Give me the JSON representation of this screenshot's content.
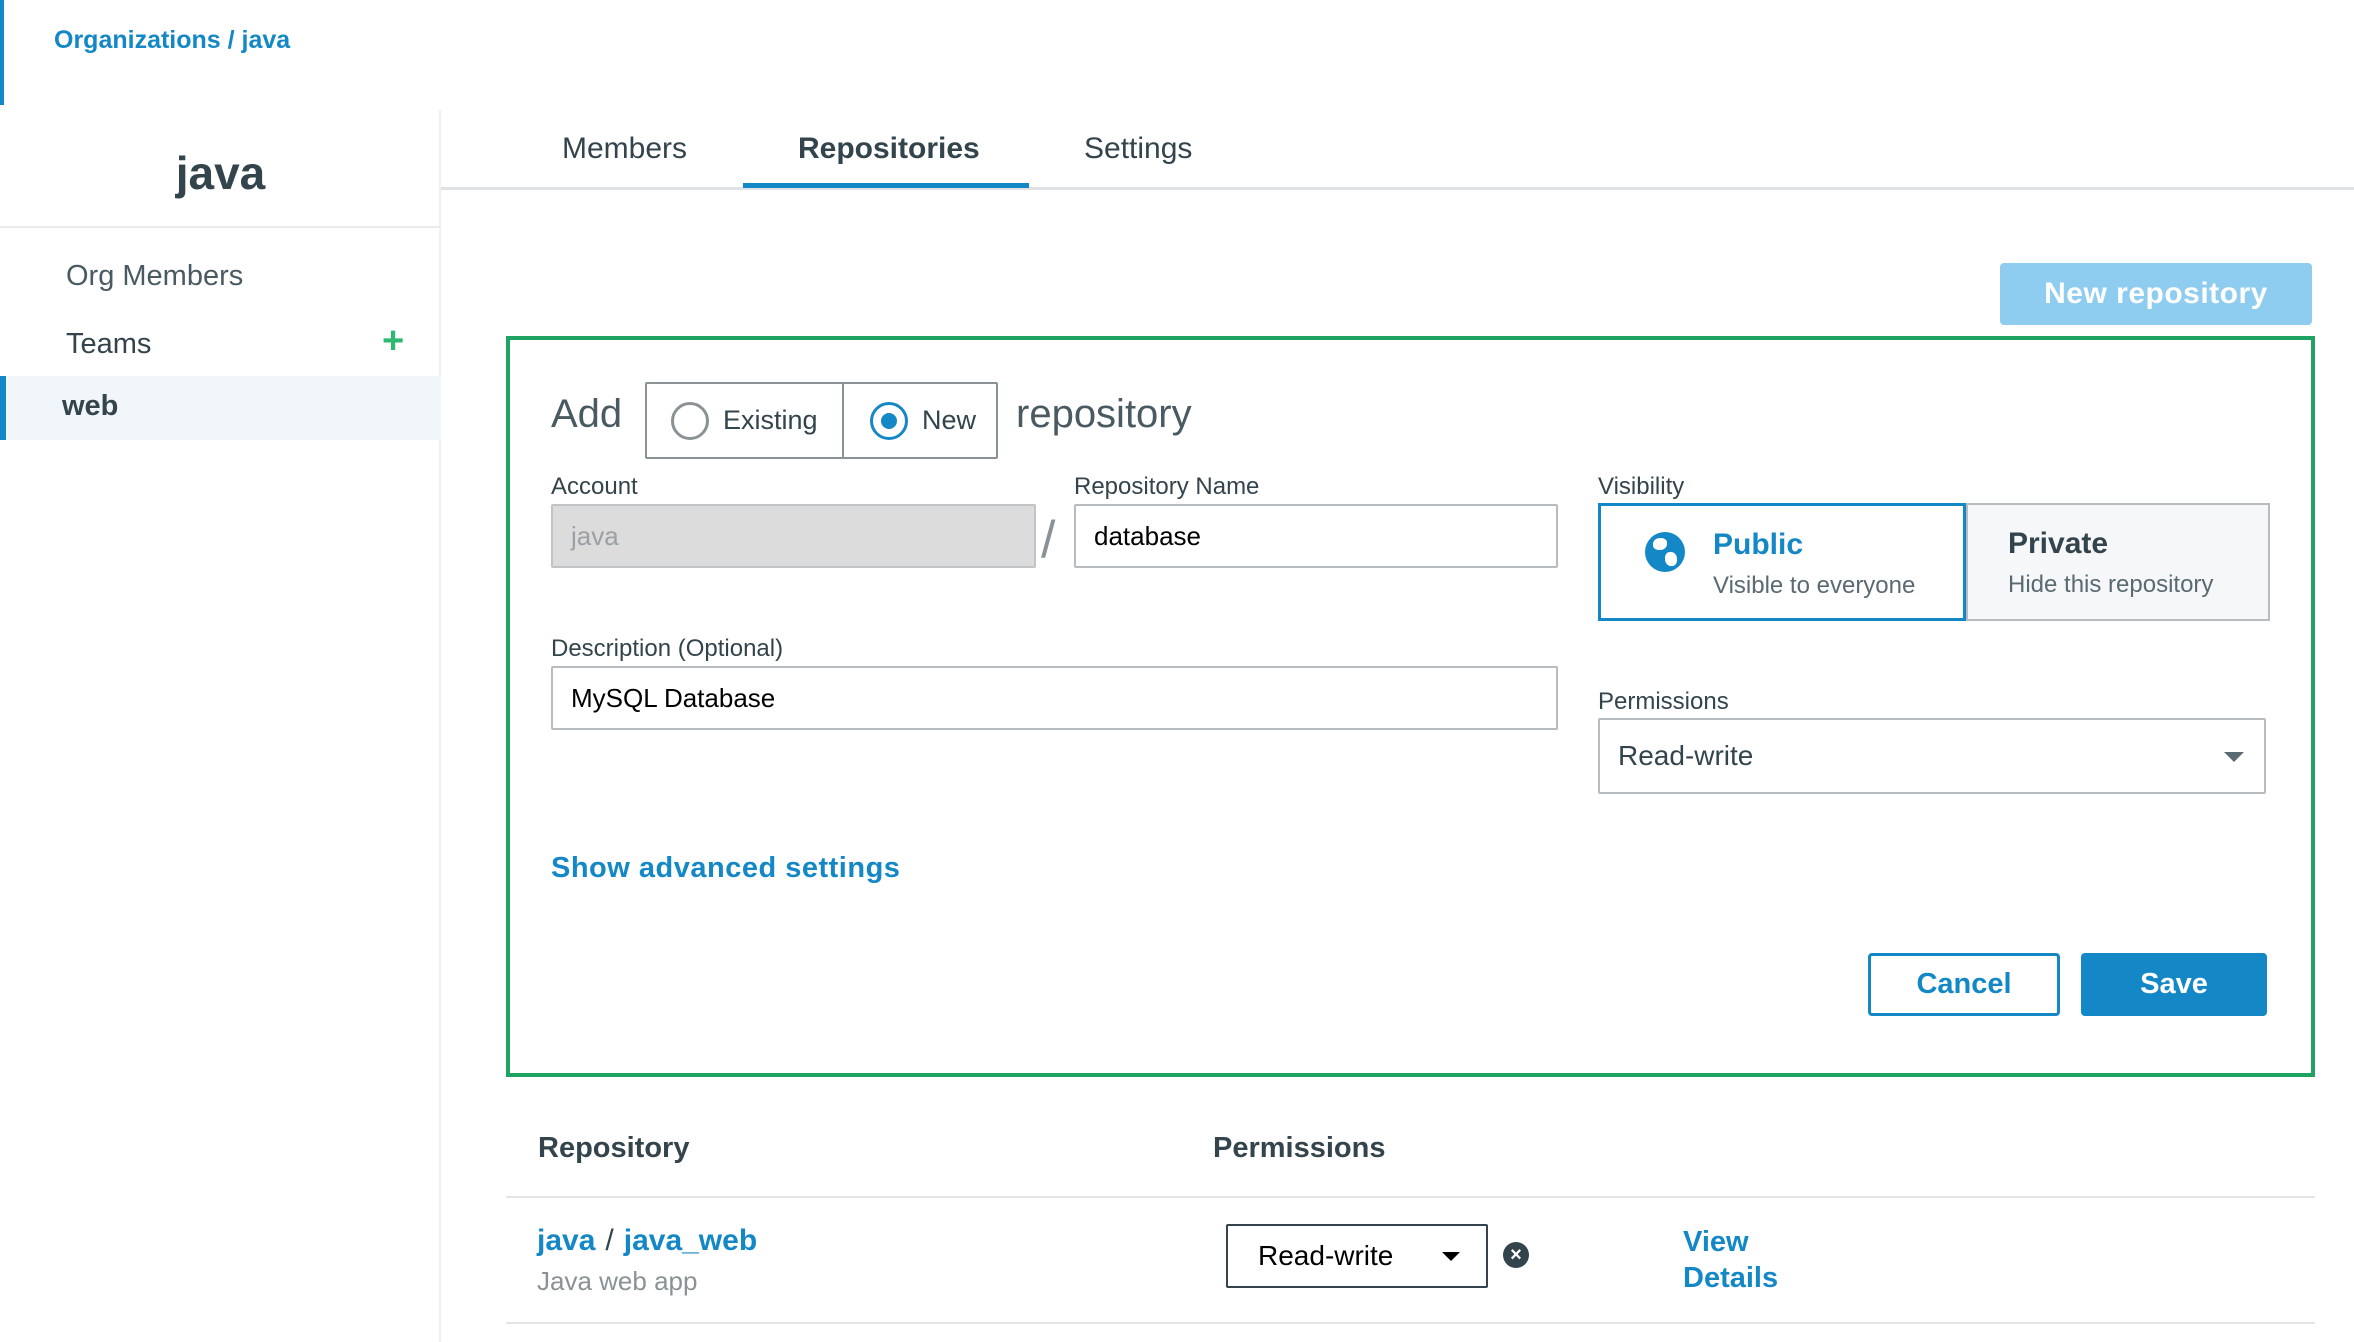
{
  "breadcrumb": {
    "root": "Organizations",
    "separator": "/",
    "current": "java"
  },
  "sidebar": {
    "org_name": "java",
    "items": [
      {
        "label": "Org Members"
      },
      {
        "label": "Teams",
        "action_icon": "plus-icon"
      },
      {
        "label": "web",
        "active": true
      }
    ]
  },
  "tabs": [
    {
      "label": "Members"
    },
    {
      "label": "Repositories",
      "active": true
    },
    {
      "label": "Settings"
    }
  ],
  "new_repository_button": "New repository",
  "form": {
    "add_label": "Add",
    "mode_options": [
      {
        "label": "Existing",
        "selected": false
      },
      {
        "label": "New",
        "selected": true
      }
    ],
    "repository_word": "repository",
    "account": {
      "label": "Account",
      "value": "java",
      "disabled": true
    },
    "slash": "/",
    "repository_name": {
      "label": "Repository Name",
      "value": "database"
    },
    "description": {
      "label": "Description (Optional)",
      "value": "MySQL Database"
    },
    "visibility": {
      "label": "Visibility",
      "options": [
        {
          "title": "Public",
          "subtitle": "Visible to everyone",
          "icon": "globe-icon",
          "selected": true
        },
        {
          "title": "Private",
          "subtitle": "Hide this repository",
          "selected": false
        }
      ]
    },
    "permissions": {
      "label": "Permissions",
      "value": "Read-write"
    },
    "advanced_link": "Show advanced settings",
    "cancel_label": "Cancel",
    "save_label": "Save"
  },
  "table": {
    "headers": {
      "repository": "Repository",
      "permissions": "Permissions"
    },
    "rows": [
      {
        "namespace": "java",
        "separator": "/",
        "name": "java_web",
        "description": "Java web app",
        "permission": "Read-write",
        "action_label": "View Details"
      }
    ]
  },
  "colors": {
    "accent": "#1488c6",
    "panel_border": "#1fa363",
    "add_icon": "#2db970",
    "disabled_button": "#8fcdf0"
  }
}
